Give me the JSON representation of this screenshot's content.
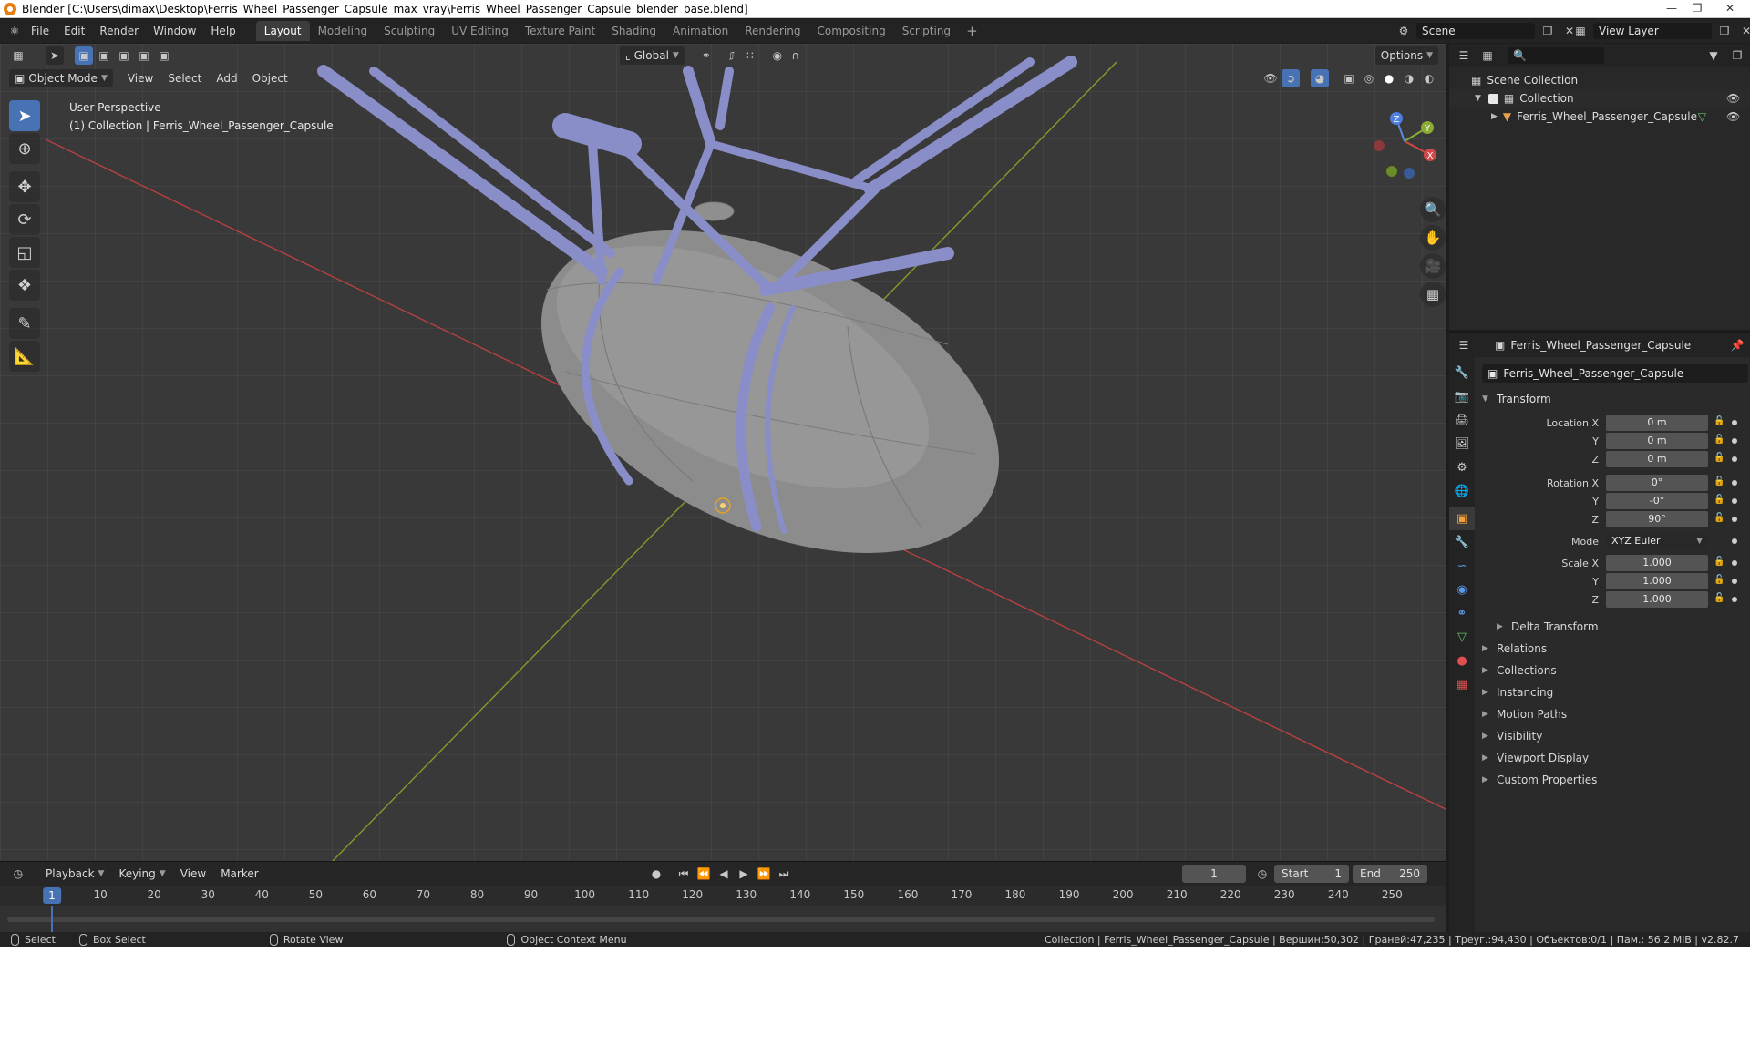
{
  "title_bar": {
    "text": "Blender [C:\\Users\\dimax\\Desktop\\Ferris_Wheel_Passenger_Capsule_max_vray\\Ferris_Wheel_Passenger_Capsule_blender_base.blend]"
  },
  "menu": [
    "File",
    "Edit",
    "Render",
    "Window",
    "Help"
  ],
  "workspaces": [
    {
      "label": "Layout",
      "active": true
    },
    {
      "label": "Modeling"
    },
    {
      "label": "Sculpting"
    },
    {
      "label": "UV Editing"
    },
    {
      "label": "Texture Paint"
    },
    {
      "label": "Shading"
    },
    {
      "label": "Animation"
    },
    {
      "label": "Rendering"
    },
    {
      "label": "Compositing"
    },
    {
      "label": "Scripting"
    }
  ],
  "scene": "Scene",
  "view_layer": "View Layer",
  "viewport": {
    "mode": "Object Mode",
    "menus": [
      "View",
      "Select",
      "Add",
      "Object"
    ],
    "orientation": "Global",
    "options_label": "Options",
    "info_line1": "User Perspective",
    "info_line2": "(1) Collection | Ferris_Wheel_Passenger_Capsule",
    "gizmo": {
      "x": "X",
      "y": "Y",
      "z": "Z"
    }
  },
  "outliner": {
    "items": [
      {
        "label": "Scene Collection"
      },
      {
        "label": "Collection"
      },
      {
        "label": "Ferris_Wheel_Passenger_Capsule"
      }
    ]
  },
  "properties": {
    "header_object": "Ferris_Wheel_Passenger_Capsule",
    "object_name": "Ferris_Wheel_Passenger_Capsule",
    "transform_title": "Transform",
    "location": {
      "label": "Location X",
      "x": "0 m",
      "y": "0 m",
      "z": "0 m"
    },
    "rotation": {
      "label": "Rotation X",
      "x": "0°",
      "y": "-0°",
      "z": "90°"
    },
    "mode": {
      "label": "Mode",
      "value": "XYZ Euler"
    },
    "scale": {
      "label": "Scale X",
      "x": "1.000",
      "y": "1.000",
      "z": "1.000"
    },
    "axis_y": "Y",
    "axis_z": "Z",
    "delta": "Delta Transform",
    "panels": [
      "Relations",
      "Collections",
      "Instancing",
      "Motion Paths",
      "Visibility",
      "Viewport Display",
      "Custom Properties"
    ]
  },
  "timeline": {
    "menus": [
      "Playback",
      "Keying",
      "View",
      "Marker"
    ],
    "current_frame": "1",
    "start_label": "Start",
    "start": "1",
    "end_label": "End",
    "end": "250",
    "ticks": [
      "10",
      "20",
      "30",
      "40",
      "50",
      "60",
      "70",
      "80",
      "90",
      "100",
      "110",
      "120",
      "130",
      "140",
      "150",
      "160",
      "170",
      "180",
      "190",
      "200",
      "210",
      "220",
      "230",
      "240",
      "250"
    ],
    "indicator": "1"
  },
  "status": {
    "select": "Select",
    "box_select": "Box Select",
    "rotate_view": "Rotate View",
    "context_menu": "Object Context Menu",
    "stats": "Collection | Ferris_Wheel_Passenger_Capsule | Вершин:50,302 | Граней:47,235 | Треуг.:94,430 | Объектов:0/1 | Пам.: 56.2 MiB | v2.82.7"
  },
  "colors": {
    "accent": "#4772b3",
    "frame": "#8a8ec8",
    "capsule": "#8a8a8a",
    "x_axis": "#c44",
    "y_axis": "#8aab34"
  }
}
